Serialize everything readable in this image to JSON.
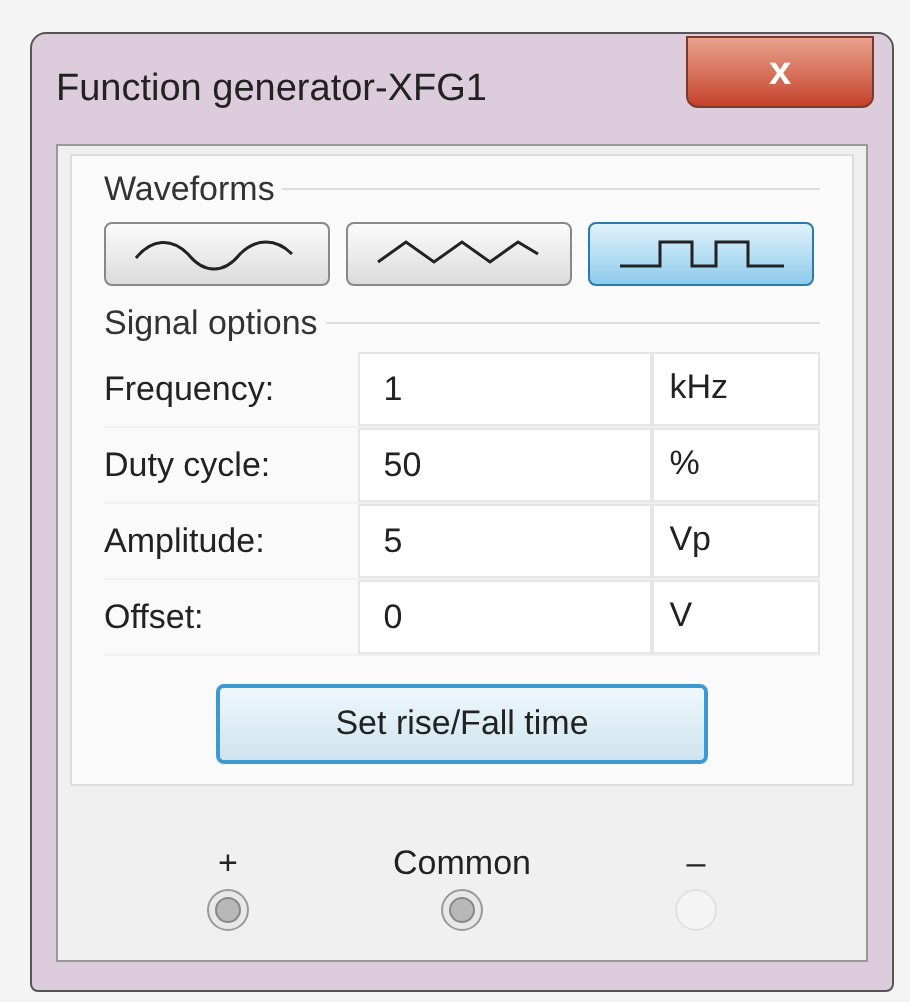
{
  "window": {
    "title": "Function generator-XFG1",
    "close": "x"
  },
  "waveforms": {
    "label": "Waveforms",
    "buttons": [
      {
        "kind": "sine",
        "selected": false
      },
      {
        "kind": "triangle",
        "selected": false
      },
      {
        "kind": "square",
        "selected": true
      }
    ]
  },
  "signal_options": {
    "label": "Signal options",
    "rows": [
      {
        "label": "Frequency:",
        "value": "1",
        "unit": "kHz"
      },
      {
        "label": "Duty cycle:",
        "value": "50",
        "unit": "%"
      },
      {
        "label": "Amplitude:",
        "value": "5",
        "unit": "Vp"
      },
      {
        "label": "Offset:",
        "value": "0",
        "unit": "V"
      }
    ]
  },
  "rise_fall_button": "Set rise/Fall time",
  "terminals": [
    {
      "label": "+",
      "connected": true
    },
    {
      "label": "Common",
      "connected": true
    },
    {
      "label": "–",
      "connected": false
    }
  ]
}
